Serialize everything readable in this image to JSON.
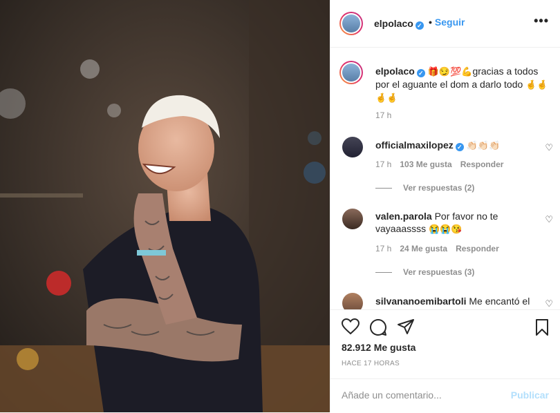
{
  "post": {
    "author": "elpolaco",
    "follow_label": "Seguir",
    "more_label": "•••"
  },
  "caption": {
    "username": "elpolaco",
    "emojis": "🎁😏💯💪",
    "text": "gracias a todos por el aguante el dom a darlo todo ",
    "emojis_end": "🤞🤞🤞🤞",
    "time": "17 h"
  },
  "comments": [
    {
      "username": "officialmaxilopez",
      "text": "",
      "emojis": "👏🏻👏🏻👏🏻",
      "time": "17 h",
      "likes": "103 Me gusta",
      "reply": "Responder",
      "view_replies": "Ver respuestas (2)"
    },
    {
      "username": "valen.parola",
      "text": "Por favor no te vayaaassss ",
      "emojis": "😭😭😘",
      "time": "17 h",
      "likes": "24 Me gusta",
      "reply": "Responder",
      "view_replies": "Ver respuestas (3)"
    },
    {
      "username": "silvananoemibartoli",
      "text": "Me encantó el"
    }
  ],
  "actions": {
    "likes": "82.912 Me gusta",
    "time_ago": "HACE 17 HORAS"
  },
  "add_comment": {
    "placeholder": "Añade un comentario...",
    "publish": "Publicar"
  },
  "colors": {
    "link_blue": "#3897f0",
    "publish_disabled": "#b2dffc",
    "muted": "#8e8e8e"
  }
}
